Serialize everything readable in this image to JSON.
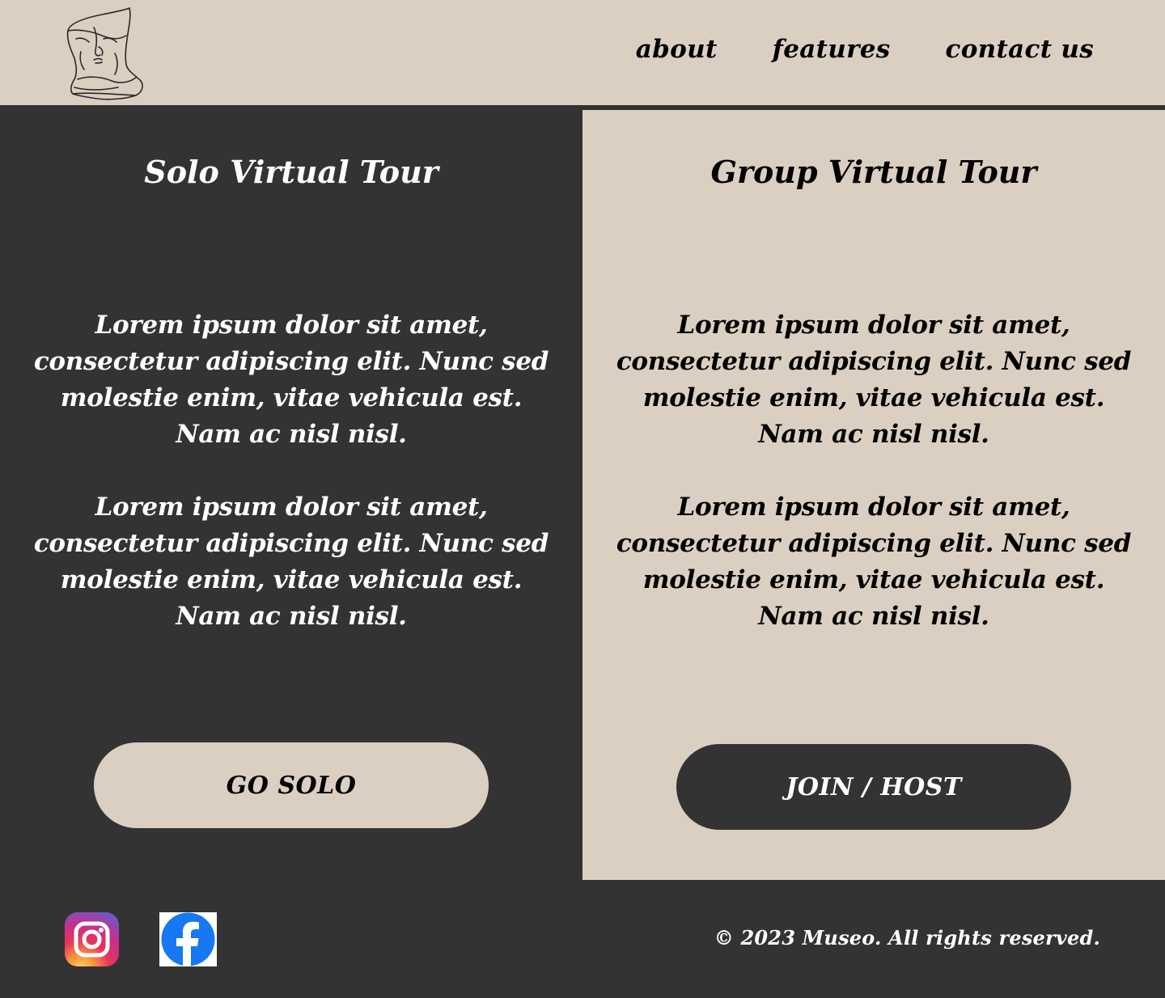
{
  "header": {
    "logo_icon": "sculpture-head-line-art-icon",
    "nav": [
      {
        "label": "about"
      },
      {
        "label": "features"
      },
      {
        "label": "contact us"
      }
    ]
  },
  "solo": {
    "title": "Solo Virtual Tour",
    "paragraphs": [
      "Lorem ipsum dolor sit amet, consectetur adipiscing elit. Nunc sed molestie enim, vitae vehicula est. Nam ac nisl nisl.",
      "Lorem ipsum dolor sit amet, consectetur adipiscing elit. Nunc sed molestie enim, vitae vehicula est. Nam ac nisl nisl."
    ],
    "button_label": "GO SOLO"
  },
  "group": {
    "title": "Group Virtual Tour",
    "paragraphs": [
      "Lorem ipsum dolor sit amet, consectetur adipiscing elit. Nunc sed molestie enim, vitae vehicula est. Nam ac nisl nisl.",
      "Lorem ipsum dolor sit amet, consectetur adipiscing elit. Nunc sed molestie enim, vitae vehicula est. Nam ac nisl nisl."
    ],
    "button_label": "JOIN / HOST"
  },
  "footer": {
    "social": [
      {
        "icon": "instagram-icon"
      },
      {
        "icon": "facebook-icon"
      }
    ],
    "copyright": "© 2023 Museo. All rights reserved."
  },
  "colors": {
    "dark": "#333333",
    "beige": "#dbcfc1",
    "facebook_blue": "#1877f2"
  }
}
